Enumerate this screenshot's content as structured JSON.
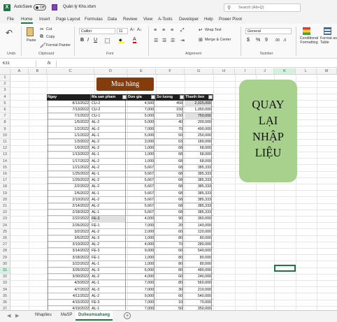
{
  "titlebar": {
    "autosave_label": "AutoSave",
    "autosave_state": "Off",
    "filename": "Quản lý Kho.xlsm",
    "search_placeholder": "Search (Alt+Q)"
  },
  "menu": [
    "File",
    "Home",
    "Insert",
    "Page Layout",
    "Formulas",
    "Data",
    "Review",
    "View",
    "A-Tools",
    "Developer",
    "Help",
    "Power Pivot"
  ],
  "ribbon": {
    "undo_label": "Undo",
    "clipboard": {
      "paste": "Paste",
      "cut": "Cut",
      "copy": "Copy",
      "format_painter": "Format Painter",
      "group": "Clipboard"
    },
    "font": {
      "name": "Calibri",
      "size": "11",
      "group": "Font"
    },
    "alignment": {
      "wrap_text": "Wrap Text",
      "merge_center": "Merge & Center",
      "group": "Alignment"
    },
    "number": {
      "format": "General",
      "group": "Number"
    },
    "conditional": "Conditional Formatting",
    "format_table": "Format as Table"
  },
  "formula_bar": {
    "name_box": "K31",
    "fx": "fx",
    "formula": ""
  },
  "columns": [
    "A",
    "B",
    "C",
    "D",
    "E",
    "F",
    "G",
    "H",
    "I",
    "J",
    "K",
    "L",
    "M"
  ],
  "rows": [
    "1",
    "2",
    "3",
    "4",
    "5",
    "6",
    "7",
    "8",
    "9",
    "10",
    "11",
    "12",
    "13",
    "14",
    "15",
    "16",
    "17",
    "18",
    "19",
    "20",
    "21",
    "22",
    "23",
    "24",
    "25",
    "26",
    "27",
    "28",
    "29",
    "30",
    "31",
    "32",
    "33",
    "34",
    "35",
    "36",
    "37"
  ],
  "title_button": "Mua hàng",
  "return_button": "QUAY LẠI NHẬP LIỆU",
  "table": {
    "headers": [
      "Ngay",
      "Ma san pham",
      "Don gia",
      "So luong",
      "Thanh tien"
    ],
    "rows": [
      [
        "8/13/2022",
        "CU-2",
        "4,500",
        "450",
        "2,025,000"
      ],
      [
        "7/13/2022",
        "CU-2",
        "7,000",
        "150",
        "1,050,000"
      ],
      [
        "7/1/2022",
        "CU-1",
        "5,000",
        "150",
        "750,000"
      ],
      [
        "1/5/2022",
        "AL-2",
        "5,000",
        "40",
        "200,000"
      ],
      [
        "1/2/2022",
        "AL-2",
        "7,000",
        "70",
        "490,000"
      ],
      [
        "1/1/2022",
        "AL-1",
        "5,000",
        "50",
        "250,000"
      ],
      [
        "1/3/2022",
        "AL-2",
        "3,000",
        "63",
        "189,000"
      ],
      [
        "1/9/2022",
        "AL-2",
        "1,000",
        "68",
        "68,000"
      ],
      [
        "1/13/2022",
        "AL-1",
        "1,000",
        "68",
        "68,000"
      ],
      [
        "1/17/2022",
        "AL-2",
        "1,000",
        "68",
        "68,000"
      ],
      [
        "1/21/2022",
        "AL-2",
        "5,667",
        "68",
        "385,333"
      ],
      [
        "1/25/2022",
        "AL-1",
        "5,667",
        "68",
        "385,333"
      ],
      [
        "1/29/2022",
        "AL-2",
        "5,667",
        "68",
        "385,333"
      ],
      [
        "2/2/2022",
        "AL-2",
        "5,667",
        "68",
        "385,333"
      ],
      [
        "2/6/2022",
        "AL-1",
        "5,667",
        "68",
        "385,333"
      ],
      [
        "2/10/2022",
        "AL-2",
        "5,667",
        "68",
        "385,333"
      ],
      [
        "2/14/2022",
        "AL-2",
        "5,667",
        "68",
        "385,333"
      ],
      [
        "2/18/2022",
        "AL-1",
        "5,667",
        "68",
        "385,333"
      ],
      [
        "2/22/2022",
        "FE-3",
        "4,000",
        "90",
        "360,000"
      ],
      [
        "2/26/2022",
        "FE-1",
        "7,000",
        "20",
        "140,000"
      ],
      [
        "3/2/2022",
        "AL-2",
        "2,000",
        "60",
        "120,000"
      ],
      [
        "3/6/2022",
        "AL-3",
        "1,000",
        "80",
        "80,000"
      ],
      [
        "3/10/2022",
        "AL-2",
        "4,000",
        "70",
        "280,000"
      ],
      [
        "3/14/2022",
        "FE-3",
        "9,000",
        "60",
        "540,000"
      ],
      [
        "3/18/2022",
        "FE-1",
        "1,000",
        "80",
        "80,000"
      ],
      [
        "3/22/2022",
        "AL-1",
        "1,000",
        "80",
        "80,000"
      ],
      [
        "3/26/2022",
        "AL-3",
        "6,000",
        "80",
        "480,000"
      ],
      [
        "3/30/2022",
        "AL-2",
        "4,000",
        "60",
        "240,000"
      ],
      [
        "4/3/2022",
        "AL-1",
        "7,000",
        "80",
        "560,000"
      ],
      [
        "4/7/2022",
        "AL-3",
        "7,000",
        "30",
        "210,000"
      ],
      [
        "4/11/2022",
        "AL-2",
        "9,000",
        "60",
        "540,000"
      ],
      [
        "4/15/2022",
        "FE-3",
        "7,000",
        "10",
        "70,000"
      ],
      [
        "4/19/2022",
        "AL-1",
        "7,000",
        "50",
        "350,000"
      ]
    ]
  },
  "sheet_tabs": [
    "Nhaplieu",
    "MaSP",
    "Dulieumuahang"
  ],
  "active_tab": "Dulieumuahang",
  "colors": {
    "excel_green": "#217346",
    "title_brown": "#843c0c",
    "return_green": "#a9d18e"
  }
}
